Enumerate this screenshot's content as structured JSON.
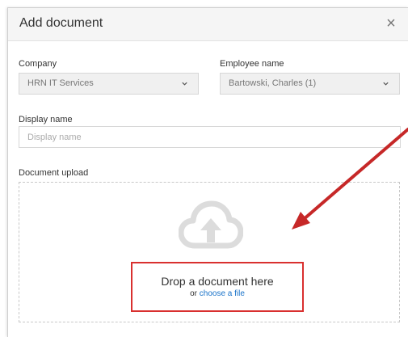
{
  "dialog": {
    "title": "Add document",
    "close_glyph": "×",
    "close_icon": "close-icon"
  },
  "form": {
    "company": {
      "label": "Company",
      "value": "HRN IT Services",
      "icon": "chevron-down-icon"
    },
    "employee": {
      "label": "Employee name",
      "value": "Bartowski, Charles (1)",
      "icon": "chevron-down-icon"
    },
    "display_name": {
      "label": "Display name",
      "placeholder": "Display name",
      "value": ""
    },
    "upload": {
      "label": "Document upload",
      "icon": "cloud-upload-icon",
      "drop_text": "Drop a document here",
      "or_text": "or",
      "choose_link": "choose a file"
    }
  },
  "annotation": {
    "arrow_color": "#c62828",
    "highlight_color": "#d9302f"
  }
}
